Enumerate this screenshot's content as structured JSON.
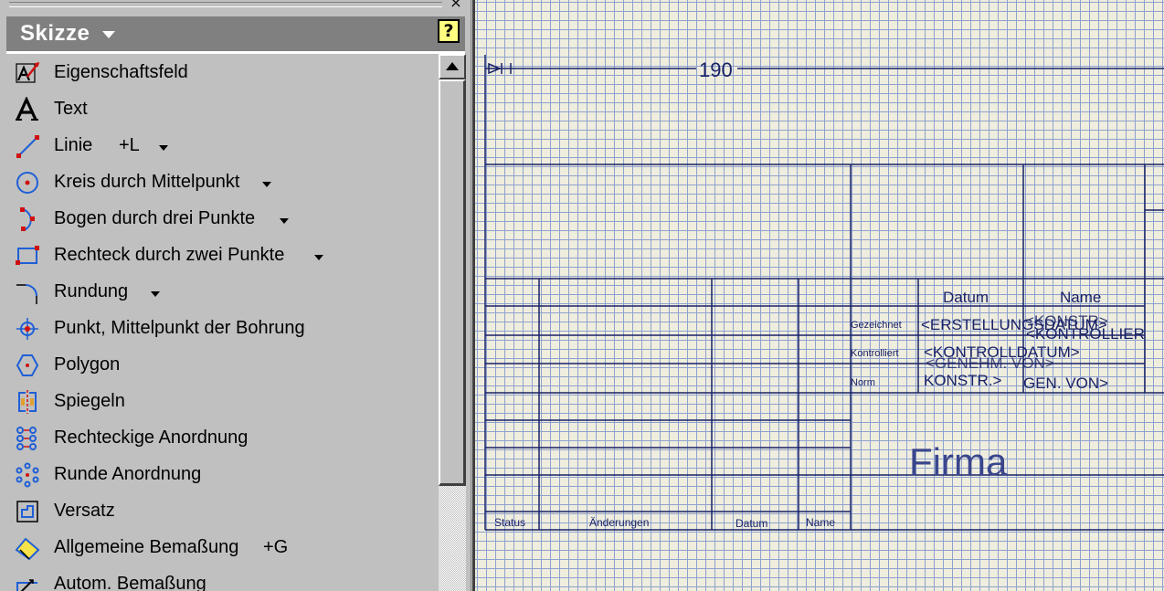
{
  "panel": {
    "close_glyph": "×",
    "title": "Skizze",
    "help_glyph": "?",
    "tools": [
      {
        "label": "Eigenschaftsfeld",
        "shortcut": "",
        "dropdown": false,
        "icon": "properties-field-icon"
      },
      {
        "label": "Text",
        "shortcut": "",
        "dropdown": false,
        "icon": "text-icon"
      },
      {
        "label": "Linie",
        "shortcut": "+L",
        "dropdown": true,
        "icon": "line-icon"
      },
      {
        "label": "Kreis durch Mittelpunkt",
        "shortcut": "",
        "dropdown": true,
        "icon": "circle-center-icon"
      },
      {
        "label": "Bogen durch drei Punkte",
        "shortcut": "",
        "dropdown": true,
        "icon": "arc-three-points-icon"
      },
      {
        "label": "Rechteck durch zwei Punkte",
        "shortcut": "",
        "dropdown": true,
        "icon": "rectangle-two-points-icon"
      },
      {
        "label": "Rundung",
        "shortcut": "",
        "dropdown": true,
        "icon": "fillet-icon"
      },
      {
        "label": "Punkt, Mittelpunkt der Bohrung",
        "shortcut": "",
        "dropdown": false,
        "icon": "hole-center-point-icon"
      },
      {
        "label": "Polygon",
        "shortcut": "",
        "dropdown": false,
        "icon": "polygon-icon"
      },
      {
        "label": "Spiegeln",
        "shortcut": "",
        "dropdown": false,
        "icon": "mirror-icon"
      },
      {
        "label": "Rechteckige Anordnung",
        "shortcut": "",
        "dropdown": false,
        "icon": "rectangular-pattern-icon"
      },
      {
        "label": "Runde Anordnung",
        "shortcut": "",
        "dropdown": false,
        "icon": "circular-pattern-icon"
      },
      {
        "label": "Versatz",
        "shortcut": "",
        "dropdown": false,
        "icon": "offset-icon"
      },
      {
        "label": "Allgemeine Bemaßung",
        "shortcut": "+G",
        "dropdown": false,
        "icon": "general-dimension-icon"
      },
      {
        "label": "Autom. Bemaßung",
        "shortcut": "",
        "dropdown": false,
        "icon": "auto-dimension-icon"
      }
    ]
  },
  "canvas": {
    "dimension_value": "190",
    "title_block": {
      "col_datum": "Datum",
      "col_name": "Name",
      "row_drawn": "Gezeichnet",
      "row_checked": "Kontrolliert",
      "row_norm": "Norm",
      "drawn_date": "<ERSTELLUNGSDATUM>",
      "drawn_name": "<KONSTR>",
      "checked_date": "<KONTROLLDATUM>",
      "checked_name": "<KONTROLLIER",
      "approved": "<GENEHM. VON>",
      "norm_konstr": "KONSTR.>",
      "norm_gen": "GEN. VON>",
      "company": "Firma",
      "rev_status": "Status",
      "rev_changes": "Änderungen",
      "rev_date": "Datum",
      "rev_name": "Name"
    }
  },
  "colors": {
    "panel_bg": "#c0c0c0",
    "header_bg": "#808080",
    "canvas_bg": "#efedde",
    "grid": "#8ea2cf",
    "frame_lines": "#1a2266",
    "icon_blue": "#1f5fd6",
    "icon_red": "#d01010"
  }
}
